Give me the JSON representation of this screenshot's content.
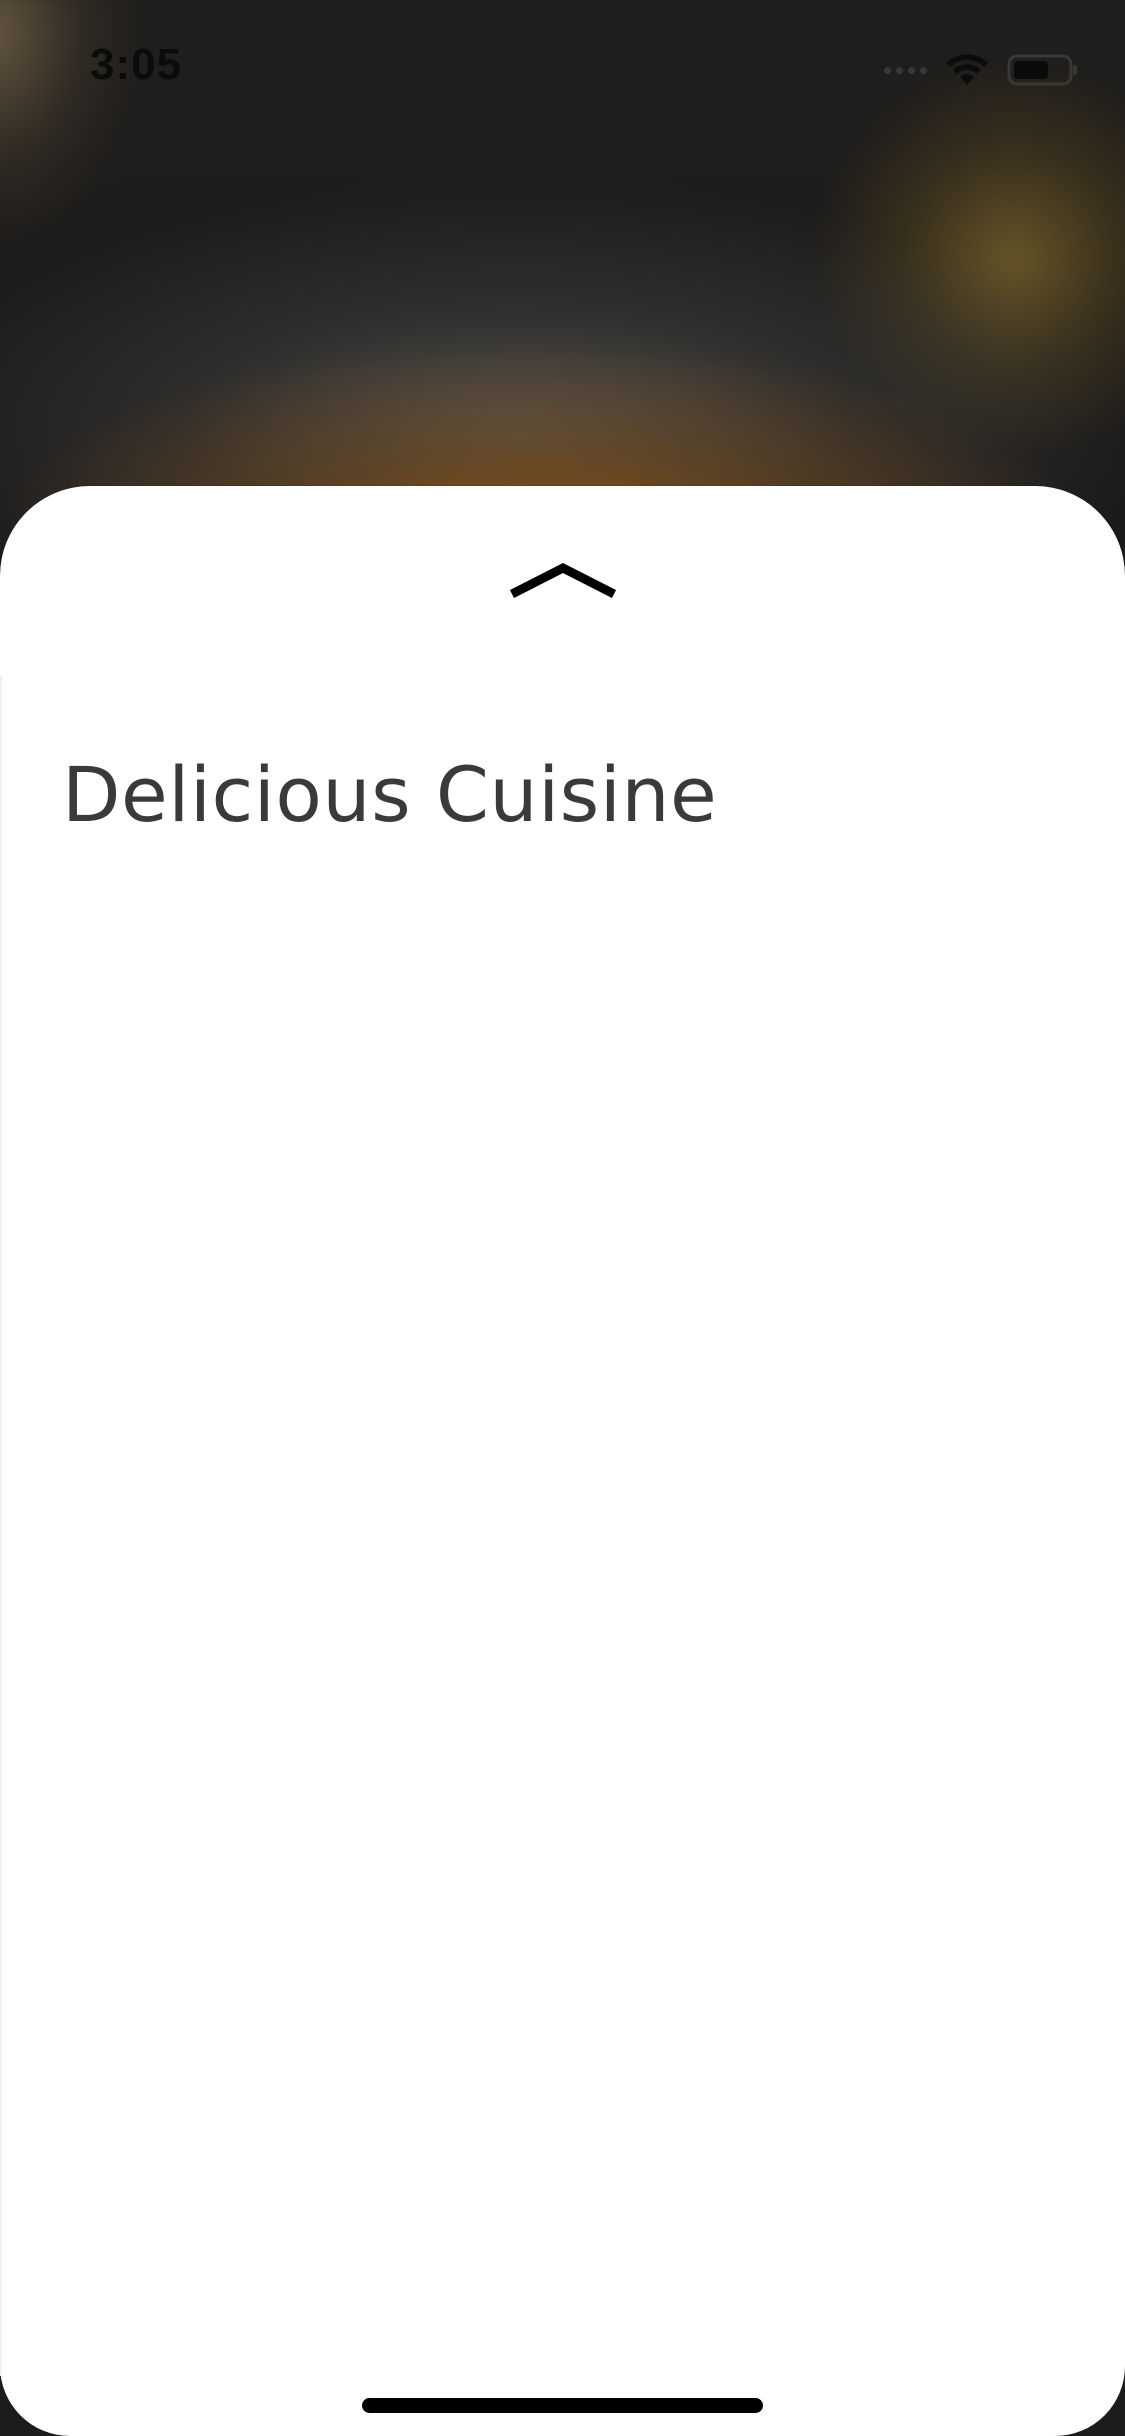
{
  "status_bar": {
    "time": "3:05",
    "signal_icon": "cellular-signal-icon",
    "wifi_icon": "wifi-icon",
    "battery_icon": "battery-icon"
  },
  "sheet": {
    "handle_icon": "chevron-up-icon",
    "title": "Delicious Cuisine"
  },
  "colors": {
    "sheet_background": "#ffffff",
    "title_text": "#3a3a3a",
    "backdrop_dark": "#1e1c1b",
    "home_indicator": "#000000"
  }
}
